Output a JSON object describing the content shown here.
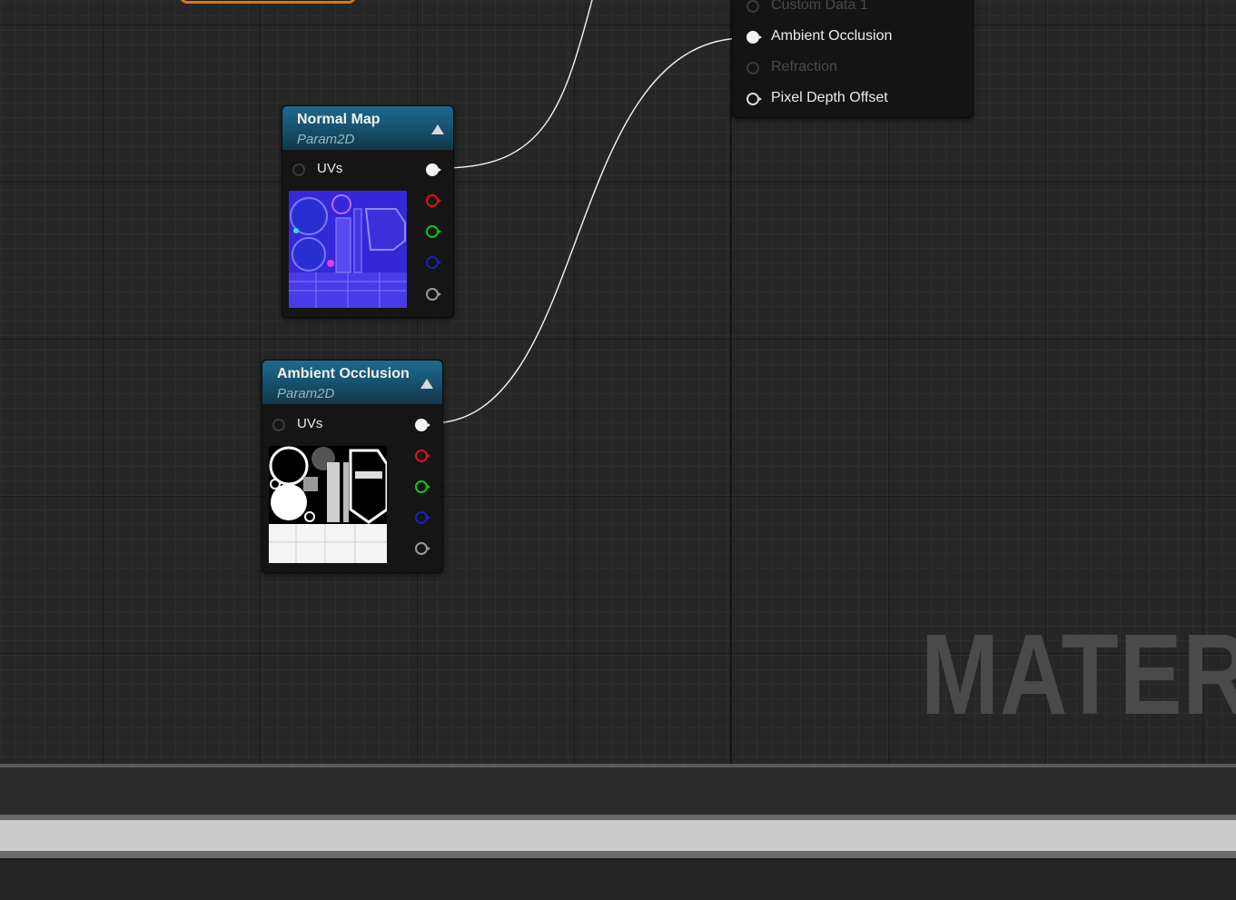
{
  "graph": {
    "watermark": "MATER",
    "nodes": {
      "normal_map": {
        "title": "Normal Map",
        "subtitle": "Param2D",
        "input_label": "UVs"
      },
      "ambient_occlusion": {
        "title": "Ambient Occlusion",
        "subtitle": "Param2D",
        "input_label": "UVs"
      }
    },
    "result_node": {
      "pins": [
        {
          "label": "Custom Data 1",
          "enabled": false
        },
        {
          "label": "Ambient Occlusion",
          "enabled": true,
          "connected": true
        },
        {
          "label": "Refraction",
          "enabled": false
        },
        {
          "label": "Pixel Depth Offset",
          "enabled": true,
          "connected": false
        }
      ]
    },
    "pin_colors": {
      "red": "#e0121c",
      "green": "#12c41c",
      "blue": "#1525b8",
      "alpha": "#9a9a9a",
      "rgb": "#f2f2f2"
    },
    "header_color": "#175471",
    "comment_color": "#d47814"
  }
}
